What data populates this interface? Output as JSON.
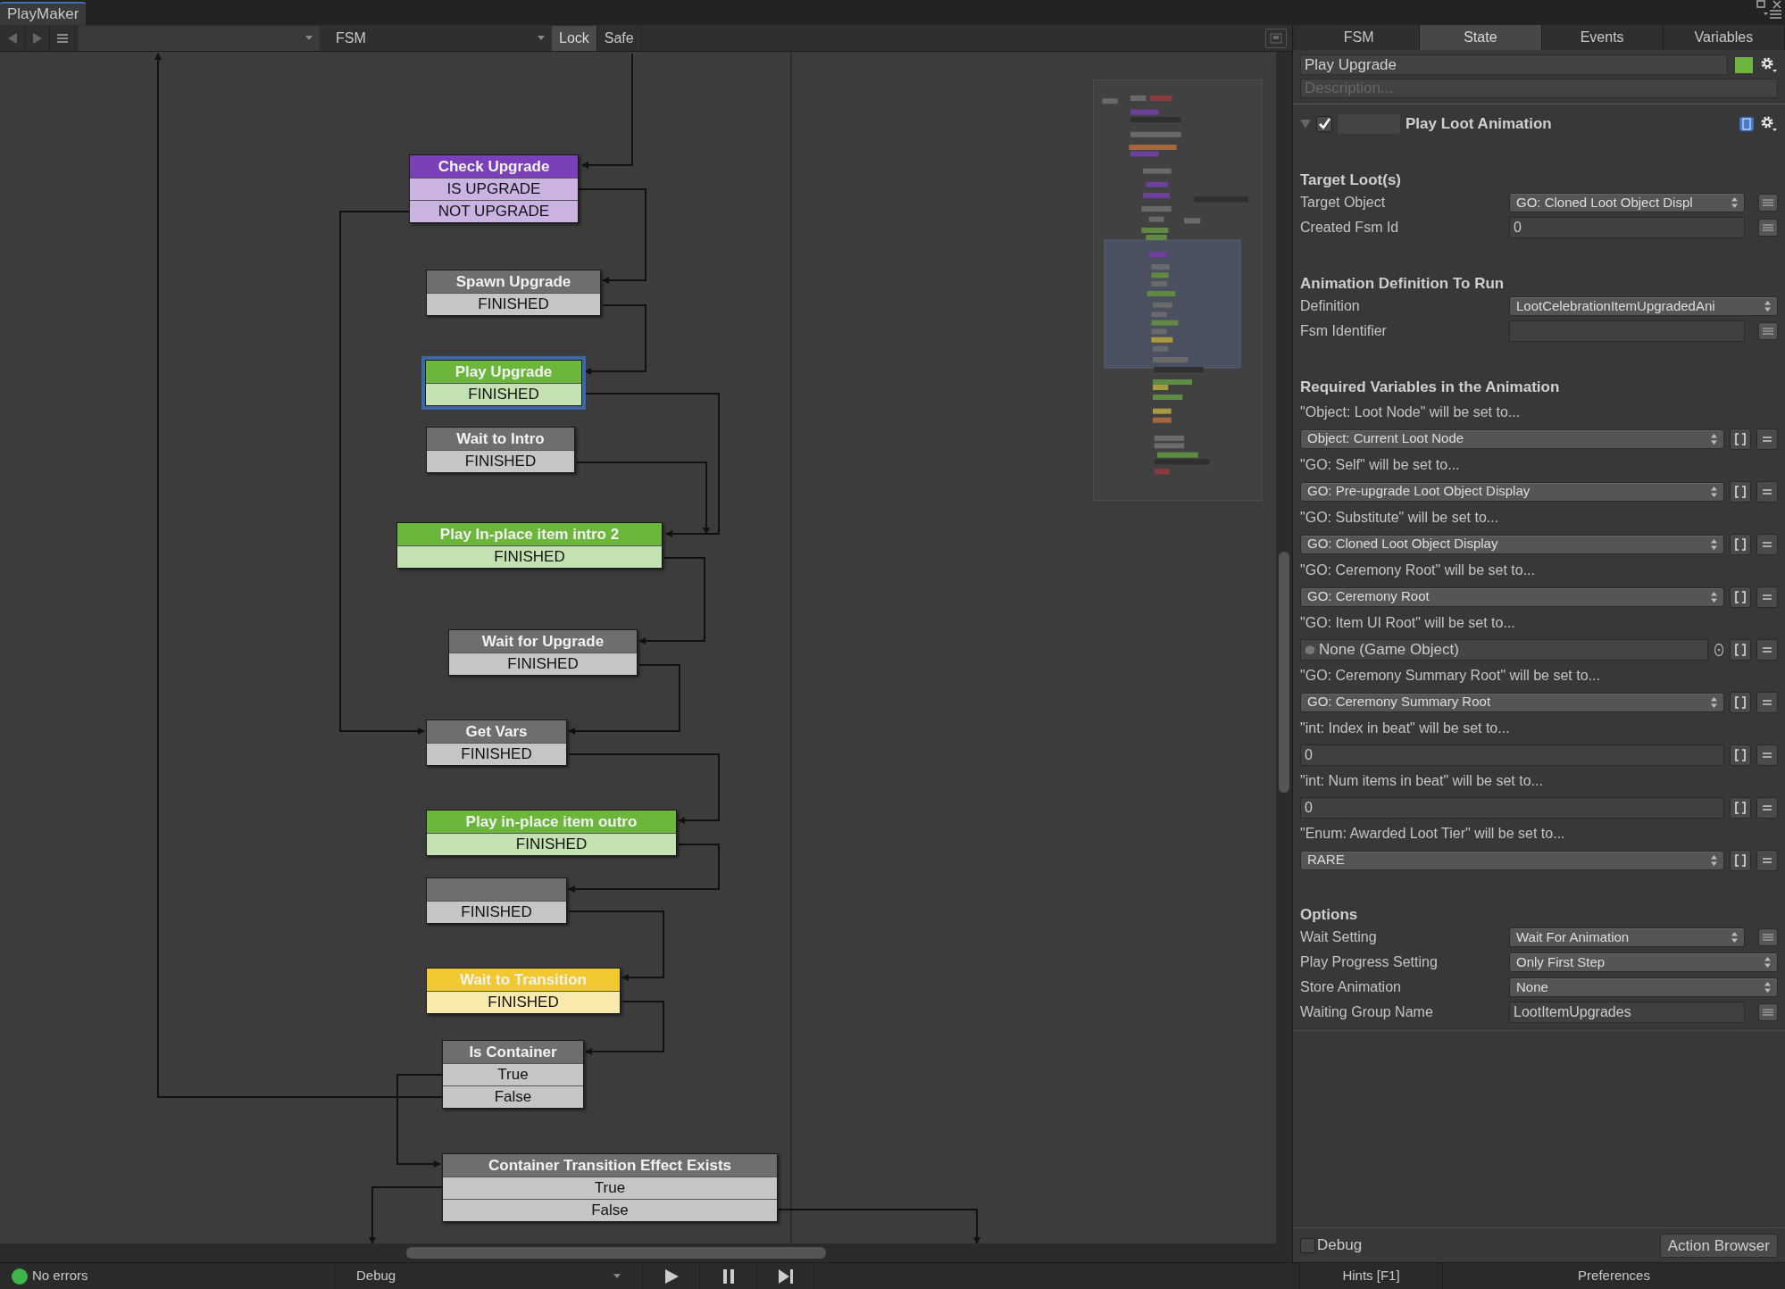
{
  "window_tab": "PlayMaker",
  "toolbar": {
    "fsm_dropdown": "FSM",
    "toggles": [
      {
        "label": "Lock",
        "selected": true
      },
      {
        "label": "Safe",
        "selected": false
      }
    ]
  },
  "graph": {
    "nodes": [
      {
        "title": "Check Upgrade",
        "color": "#7b3fb8",
        "selected": false,
        "events": [
          "IS UPGRADE",
          "NOT UPGRADE"
        ]
      },
      {
        "title": "Spawn Upgrade",
        "color": "#6e6e6e",
        "selected": false,
        "events": [
          "FINISHED"
        ]
      },
      {
        "title": "Play Upgrade",
        "color": "#6cb63c",
        "selected": true,
        "events": [
          "FINISHED"
        ]
      },
      {
        "title": "Wait to Intro",
        "color": "#6e6e6e",
        "selected": false,
        "events": [
          "FINISHED"
        ]
      },
      {
        "title": "Play In-place item intro 2",
        "color": "#6cb63c",
        "selected": false,
        "events": [
          "FINISHED"
        ]
      },
      {
        "title": "Wait for Upgrade",
        "color": "#6e6e6e",
        "selected": false,
        "events": [
          "FINISHED"
        ]
      },
      {
        "title": "Get Vars",
        "color": "#6e6e6e",
        "selected": false,
        "events": [
          "FINISHED"
        ]
      },
      {
        "title": "Play in-place item outro",
        "color": "#6cb63c",
        "selected": false,
        "events": [
          "FINISHED"
        ]
      },
      {
        "color": "#6e6e6e",
        "selected": false,
        "events": [
          "FINISHED"
        ]
      },
      {
        "title": "Wait to Transition",
        "color": "#f0c830",
        "selected": false,
        "events": [
          "FINISHED"
        ]
      },
      {
        "title": "Is Container",
        "color": "#6e6e6e",
        "selected": false,
        "events": [
          "True",
          "False"
        ]
      },
      {
        "title": "Container Transition Effect Exists",
        "color": "#6e6e6e",
        "selected": false,
        "events": [
          "True",
          "False"
        ]
      }
    ]
  },
  "status_bar": {
    "status": "No errors",
    "mode": "Debug"
  },
  "inspector": {
    "tabs": [
      {
        "label": "FSM",
        "selected": false
      },
      {
        "label": "State",
        "selected": true
      },
      {
        "label": "Events",
        "selected": false
      },
      {
        "label": "Variables",
        "selected": false
      }
    ],
    "state_name": "Play Upgrade",
    "description_placeholder": "Description...",
    "action": {
      "title": "Play Loot Animation",
      "enabled": true,
      "expanded": true
    },
    "sections": [
      {
        "heading": "Target Loot(s)",
        "fields": [
          {
            "label": "Target Object",
            "kind": "dropdown",
            "value": "GO: Cloned Loot Object Displ",
            "variable_button": true
          },
          {
            "label": "Created Fsm Id",
            "kind": "text",
            "value": "0",
            "variable_button": true
          }
        ]
      },
      {
        "heading": "Animation Definition To Run",
        "fields": [
          {
            "label": "Definition",
            "kind": "dropdown",
            "value": "LootCelebrationItemUpgradedAni",
            "variable_button": false
          },
          {
            "label": "Fsm Identifier",
            "kind": "text",
            "variable_button": true
          }
        ]
      },
      {
        "heading": "Required Variables in the Animation",
        "variables": [
          {
            "label": "\"Object: Loot Node\" will be set to...",
            "kind": "dropdown",
            "value": "Object: Current Loot Node"
          },
          {
            "label": "\"GO: Self\" will be set to...",
            "kind": "dropdown",
            "value": "GO: Pre-upgrade Loot Object Display"
          },
          {
            "label": "\"GO: Substitute\" will be set to...",
            "kind": "dropdown",
            "value": "GO: Cloned Loot Object Display"
          },
          {
            "label": "\"GO: Ceremony Root\" will be set to...",
            "kind": "dropdown",
            "value": "GO: Ceremony Root"
          },
          {
            "label": "\"GO: Item UI Root\" will be set to...",
            "kind": "object",
            "value": "None (Game Object)"
          },
          {
            "label": "\"GO: Ceremony Summary Root\" will be set to...",
            "kind": "dropdown",
            "value": "GO: Ceremony Summary Root"
          },
          {
            "label": "\"int: Index in beat\" will be set to...",
            "kind": "text",
            "value": "0"
          },
          {
            "label": "\"int: Num items in beat\" will be set to...",
            "kind": "text",
            "value": "0"
          },
          {
            "label": "\"Enum: Awarded Loot Tier\" will be set to...",
            "kind": "dropdown",
            "value": "RARE"
          }
        ]
      },
      {
        "heading": "Options",
        "fields": [
          {
            "label": "Wait Setting",
            "kind": "dropdown",
            "value": "Wait For Animation",
            "variable_button": true
          },
          {
            "label": "Play Progress Setting",
            "kind": "dropdown",
            "value": "Only First Step",
            "variable_button": false
          },
          {
            "label": "Store Animation",
            "kind": "dropdown",
            "value": "None",
            "variable_button": false
          },
          {
            "label": "Waiting Group Name",
            "kind": "text",
            "value": "LootItemUpgrades",
            "variable_button": true
          }
        ]
      }
    ],
    "debug": {
      "label": "Debug",
      "checked": false
    },
    "action_browser": "Action Browser",
    "bottom_tabs": [
      "Hints [F1]",
      "Preferences"
    ]
  }
}
